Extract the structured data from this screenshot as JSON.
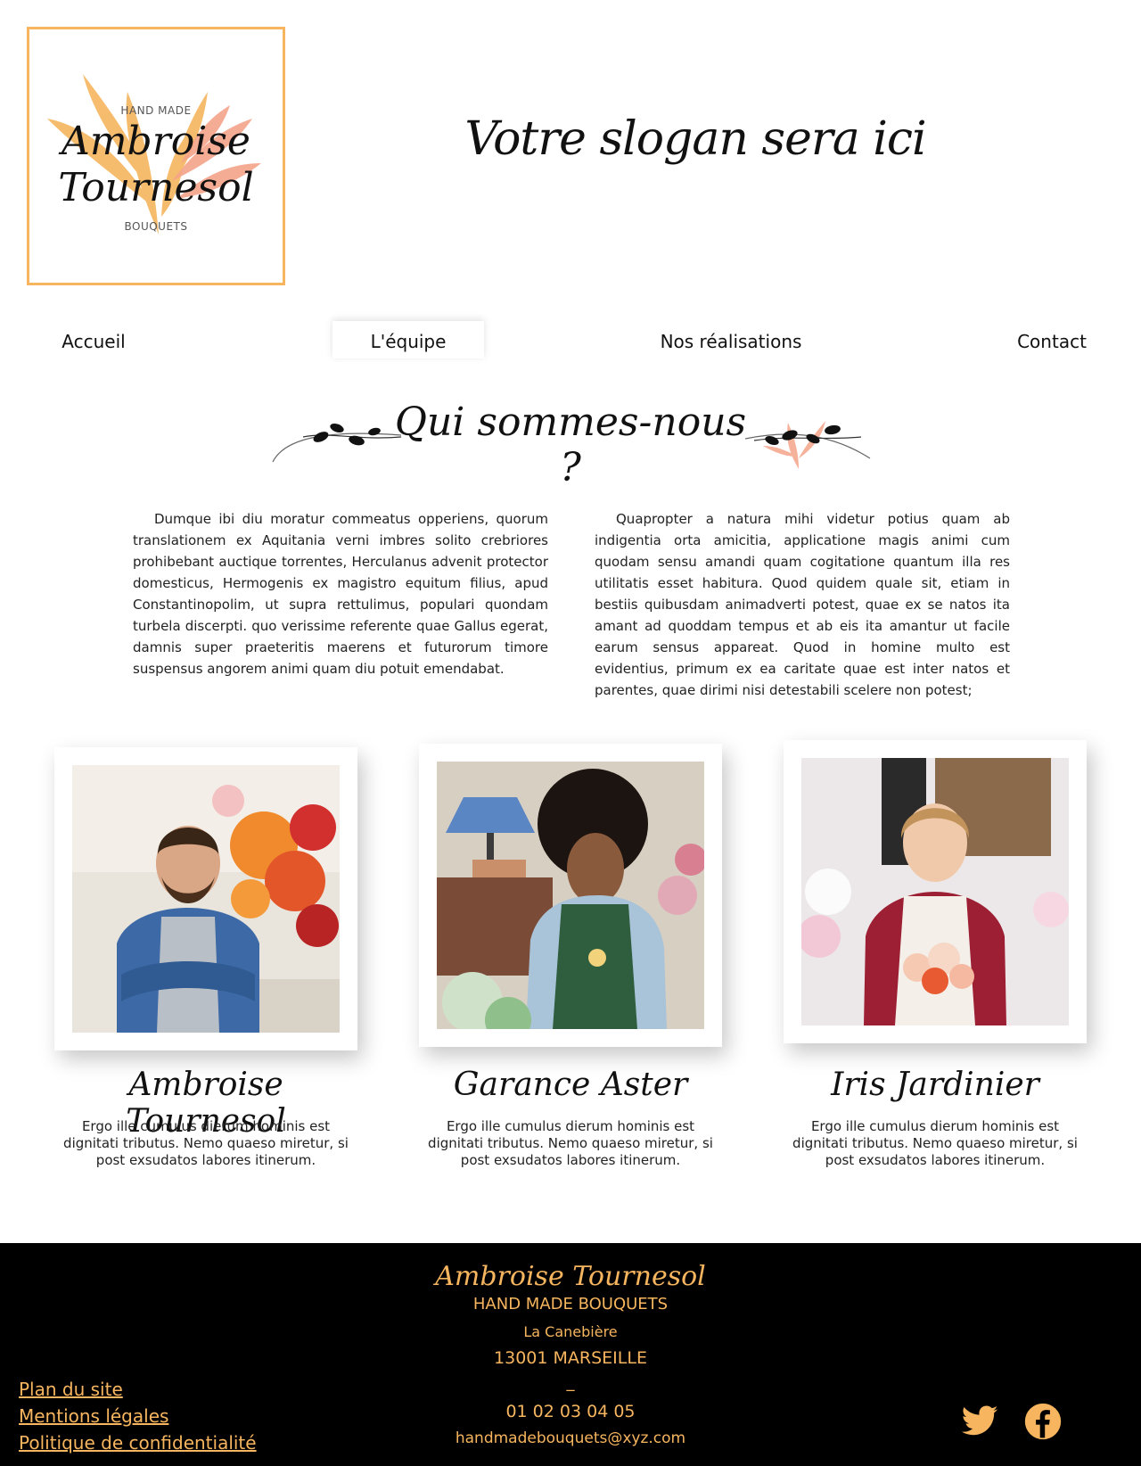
{
  "logo": {
    "top_text": "HAND MADE",
    "name_line1": "Ambroise",
    "name_line2": "Tournesol",
    "bottom_text": "BOUQUETS"
  },
  "header": {
    "slogan": "Votre slogan sera ici"
  },
  "nav": {
    "items": [
      {
        "label": "Accueil",
        "active": false
      },
      {
        "label": "L'équipe",
        "active": true
      },
      {
        "label": "Nos réalisations",
        "active": false
      },
      {
        "label": "Contact",
        "active": false
      }
    ]
  },
  "section": {
    "title": "Qui sommes-nous ?"
  },
  "intro": {
    "left": "Dumque ibi diu moratur commeatus opperiens, quorum translationem ex Aquitania verni imbres solito crebriores prohibebant auctique torrentes, Herculanus advenit protector domesticus, Hermogenis ex magistro equitum filius, apud Constantinopolim, ut supra rettulimus, populari quondam turbela discerpti. quo verissime referente quae Gallus egerat, damnis super praeteritis maerens et futurorum timore suspensus angorem animi quam diu potuit emendabat.",
    "right": "Quapropter a natura mihi videtur potius quam ab indigentia orta amicitia, applicatione magis animi cum quodam sensu amandi quam cogitatione quantum illa res utilitatis esset habitura. Quod quidem quale sit, etiam in bestiis quibusdam animadverti potest, quae ex se natos ita amant ad quoddam tempus et ab eis ita amantur ut facile earum sensus appareat. Quod in homine multo est evidentius, primum ex ea caritate quae est inter natos et parentes, quae dirimi nisi detestabili scelere non potest;"
  },
  "team": [
    {
      "name": "Ambroise Tournesol",
      "bio": "Ergo ille cumulus dierum hominis est dignitati tributus. Nemo quaeso miretur, si post exsudatos labores itinerum."
    },
    {
      "name": "Garance Aster",
      "bio": "Ergo ille cumulus dierum hominis est dignitati tributus. Nemo quaeso miretur, si post exsudatos labores itinerum."
    },
    {
      "name": "Iris Jardinier",
      "bio": "Ergo ille cumulus dierum hominis est dignitati tributus. Nemo quaeso miretur, si post exsudatos labores itinerum."
    }
  ],
  "footer": {
    "brand": "Ambroise Tournesol",
    "subtitle": "HAND MADE BOUQUETS",
    "street": "La Canebière",
    "city": "13001 MARSEILLE",
    "separator": "_",
    "phone": "01 02 03 04 05",
    "email": "handmadebouquets@xyz.com",
    "links": [
      "Plan du site",
      "Mentions légales",
      "Politique de confidentialité"
    ],
    "social": [
      "twitter-icon",
      "facebook-icon"
    ]
  },
  "colors": {
    "accent": "#f6b55e",
    "peach": "#f5a48a",
    "footer_bg": "#000000"
  }
}
